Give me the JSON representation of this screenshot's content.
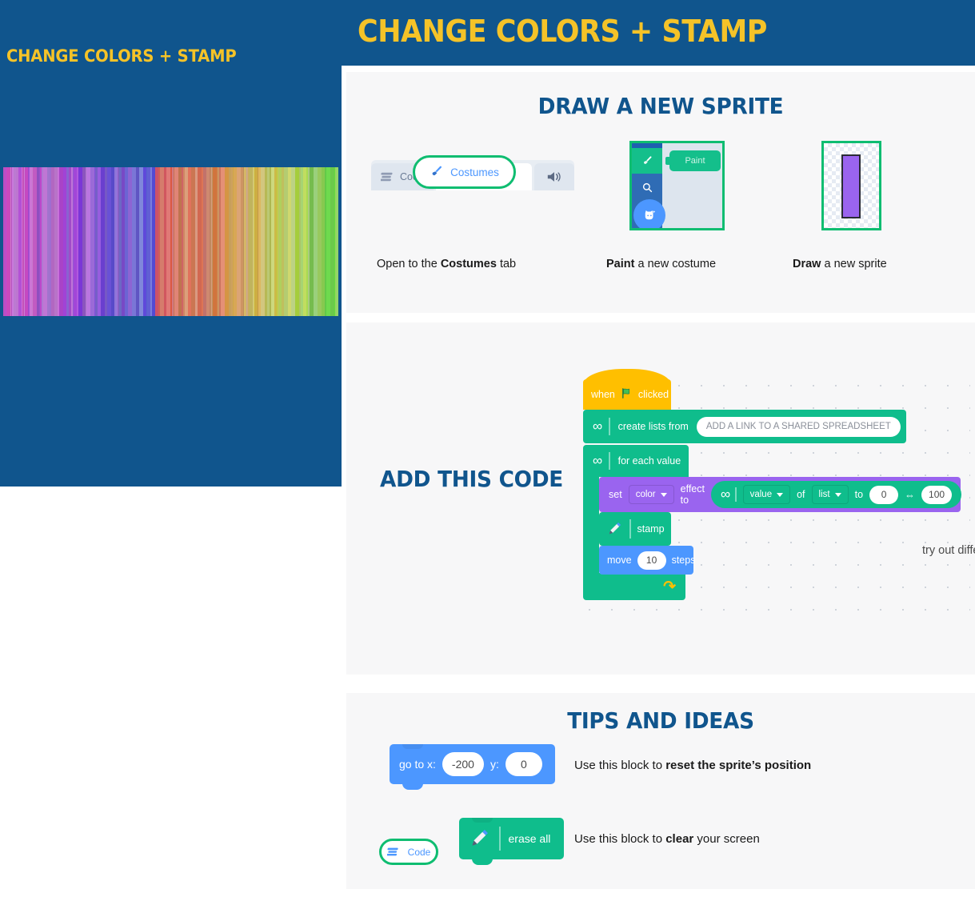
{
  "left": {
    "title": "CHANGE COLORS + STAMP",
    "art_name": "color-stripes-artwork"
  },
  "header": {
    "title": "CHANGE COLORS + STAMP",
    "bg": "#10558d",
    "fg": "#f5c328"
  },
  "sections": {
    "draw": {
      "title": "DRAW A NEW SPRITE",
      "tabbar": {
        "code_label": "Code",
        "costumes_label": "Costumes",
        "speaker_label": ""
      },
      "paint_shot": {
        "paint_label": "Paint"
      },
      "captions": {
        "open": {
          "pre": "Open  to the ",
          "bold": "Costumes",
          "post": " tab"
        },
        "paint": {
          "bold": "Paint",
          "post": " a new costume"
        },
        "draw": {
          "bold": "Draw",
          "post": " a new sprite"
        }
      }
    },
    "code": {
      "title": "ADD THIS CODE",
      "tabbar": {
        "code_label": "Code",
        "costumes_label": "Costumes",
        "sounds_label": "Sounds"
      },
      "blocks": {
        "hat_when": "when",
        "hat_clicked": "clicked",
        "create_lists_from": "create lists from",
        "spreadsheet_placeholder": "ADD A LINK TO A SHARED SPREADSHEET",
        "for_each_value": "for each value",
        "set": "set",
        "color_dropdown": "color",
        "effect_to": "effect to",
        "value_dropdown": "value",
        "of": "of",
        "list_dropdown": "list",
        "to": "to",
        "range_min": "0",
        "range_max": "100",
        "stamp": "stamp",
        "move": "move",
        "move_steps_value": "10",
        "steps": "steps"
      },
      "annotation": "try out different numbers"
    },
    "tips": {
      "title": "TIPS AND IDEAS",
      "goto_block": {
        "go_to_x": "go to x:",
        "x_value": "-200",
        "y_label": "y:",
        "y_value": "0"
      },
      "goto_text": {
        "pre": "Use this block to ",
        "bold": "reset the sprite’s position"
      },
      "erase_block": {
        "label": "erase all"
      },
      "erase_text": {
        "pre": "Use this block to ",
        "bold": "clear",
        "post": " your screen"
      }
    }
  },
  "colors": {
    "brand_blue": "#10558d",
    "brand_yellow": "#f5c328",
    "scratch_green": "#0fbd8c",
    "scratch_purple": "#9a64ef",
    "scratch_blue": "#4c97ff",
    "scratch_yellow": "#ffbf00",
    "highlight_green": "#0fbd71",
    "card_bg": "#f7f7f8"
  }
}
